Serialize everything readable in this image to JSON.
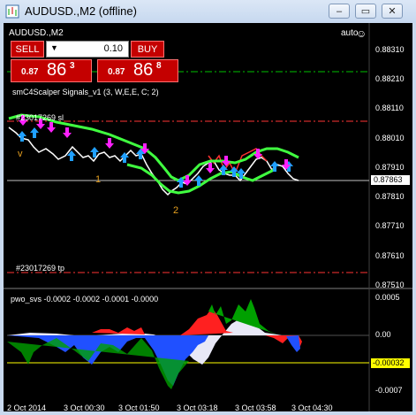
{
  "window": {
    "title": "AUDUSD.,M2 (offline)",
    "minimize": "–",
    "restore": "▭",
    "close": "✕"
  },
  "chart": {
    "symbol_label": "AUDUSD.,M2",
    "auto_label": "auto",
    "smiley": "☺",
    "indicator_label": "smC4Scalper Signals_v1 (3, W,E,E, C; 2)",
    "order_sl_label": "#23017269 sl",
    "order_tp_label": "#23017269 tp",
    "wave_labels": [
      "v",
      "1",
      "2"
    ],
    "bid_tag": "0.87863",
    "price_axis": [
      "0.88310",
      "0.88210",
      "0.88110",
      "0.88010",
      "0.87910",
      "0.87810",
      "0.87710",
      "0.87610",
      "0.87510"
    ],
    "colors": {
      "sl_line": "#ff3333",
      "tp_line": "#ff3333",
      "entry_line": "#00c000",
      "bid_line": "#c0c0c0",
      "band": "#40ff40",
      "buy_arrow": "#20a0ff",
      "sell_arrow": "#ff20ff"
    }
  },
  "trade_panel": {
    "sell_label": "SELL",
    "buy_label": "BUY",
    "lot_value": "0.10",
    "lot_arrow": "▼",
    "sell_price_prefix": "0.87",
    "sell_price_big": "86",
    "sell_price_sup": "3",
    "buy_price_prefix": "0.87",
    "buy_price_big": "86",
    "buy_price_sup": "8"
  },
  "subwindow": {
    "label": "pwo_svs -0.0002 -0.0002 -0.0001 -0.0000",
    "axis": [
      "0.0005",
      "0.00",
      "-0.0007"
    ],
    "tag": "-0.00032"
  },
  "time_axis": [
    "2 Oct 2014",
    "3 Oct 00:30",
    "3 Oct 01:50",
    "3 Oct 02:30",
    "3 Oct 03:18",
    "3 Oct 03:58",
    "3 Oct 04:30"
  ]
}
